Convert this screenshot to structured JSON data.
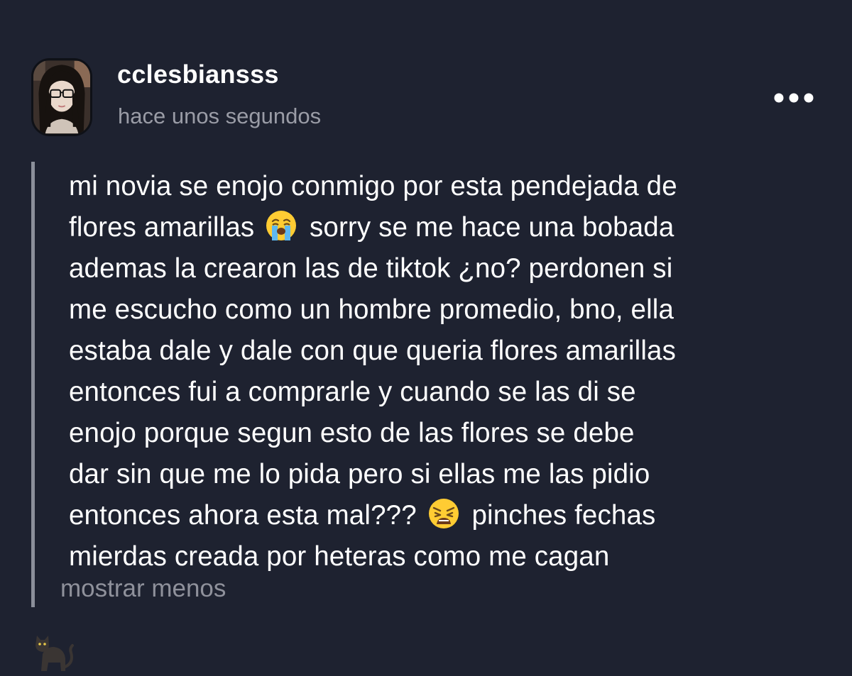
{
  "post": {
    "username": "cclesbiansss",
    "timestamp": "hace unos segundos",
    "more_icon": "ellipsis-horizontal-icon",
    "lines": {
      "l1": "mi novia se enojo conmigo por esta pendejada de",
      "l2a": "flores amarillas",
      "l2b": "sorry se me hace una bobada",
      "l3": "ademas la crearon las de tiktok ¿no? perdonen si",
      "l4": "me escucho como un hombre promedio, bno, ella",
      "l5": "estaba dale y dale con que queria flores amarillas",
      "l6": "entonces fui a comprarle y cuando se las di se",
      "l7": "enojo porque segun esto de las flores se debe",
      "l8": "dar sin que me lo pida pero si ellas me las pidio",
      "l9a": "entonces ahora esta mal???",
      "l9b": "pinches fechas",
      "l10": "mierdas creada por heteras como me cagan"
    },
    "emojis": [
      "loudly-crying-face-emoji",
      "weary-face-emoji"
    ],
    "show_less": "mostrar menos",
    "tag_icon": "black-cat-emoji"
  },
  "colors": {
    "background": "#1e2230",
    "text": "#ffffff",
    "muted": "#9a9ca6",
    "quote_bar": "#8b8f9a"
  }
}
